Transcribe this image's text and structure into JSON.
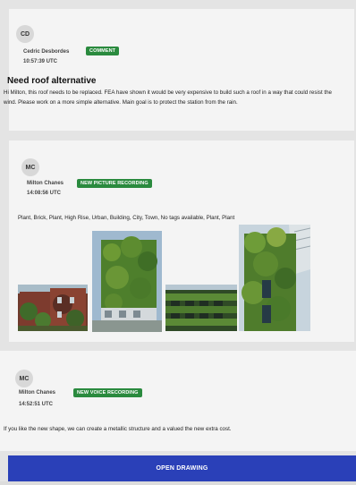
{
  "entries": [
    {
      "initials": "CD",
      "author": "Cedric Desbordes",
      "badge": "COMMENT",
      "time": "10:57:39 UTC",
      "title": "Need roof alternative",
      "body": "Hi Milton, this roof needs to be replaced. FEA have shown it would be very expensive to build such a roof in a way that could resist the wind. Please work on a more simple alternative. Main goal is to protect the station from the rain."
    },
    {
      "initials": "MC",
      "author": "Milton Chanes",
      "badge": "NEW PICTURE RECORDING",
      "time": "14:08:56 UTC",
      "tags": "Plant, Brick, Plant, High Rise, Urban, Building, City, Town, No tags available, Plant, Plant",
      "photos": [
        "ivy-covered-brick-building",
        "green-wall-tower",
        "green-facade-building",
        "vertical-garden-tower"
      ]
    },
    {
      "initials": "MC",
      "author": "Milton Chanes",
      "badge": "NEW VOICE RECORDING",
      "time": "14:52:51 UTC",
      "body": "If you like the new shape, we can create a metallic structure and a valued the new extra cost."
    }
  ],
  "actions": {
    "open_drawing_label": "OPEN DRAWING"
  },
  "colors": {
    "badge": "#2a8a3e",
    "button": "#2a40b8",
    "card": "#f4f4f4",
    "background": "#e4e4e4"
  }
}
